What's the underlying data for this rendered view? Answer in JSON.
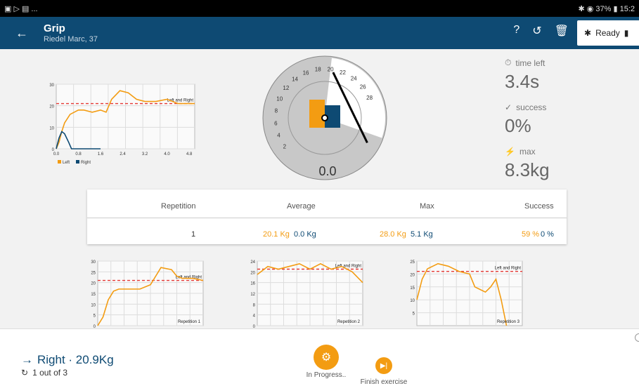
{
  "status_bar": {
    "left": "▣ ▷ ▤ ...",
    "right": "✱ ◉ 37% ▮ 15:2"
  },
  "app_bar": {
    "title": "Grip",
    "subtitle": "Riedel Marc, 37",
    "status_label": "Ready"
  },
  "gauge": {
    "value_text": "0.0",
    "ticks": [
      "2",
      "4",
      "6",
      "8",
      "10",
      "12",
      "14",
      "16",
      "18",
      "20",
      "22",
      "24",
      "26",
      "28"
    ],
    "range": [
      0,
      30
    ],
    "needle_value": 20.5,
    "highlight_start": 20
  },
  "stats": {
    "time_left_label": "time left",
    "time_left": "3.4s",
    "success_label": "success",
    "success": "0%",
    "max_label": "max",
    "max": "8.3kg"
  },
  "table": {
    "headers": [
      "Repetition",
      "Average",
      "Max",
      "Success"
    ],
    "row": {
      "repetition": "1",
      "avg_left": "20.1 Kg",
      "avg_right": "0.0 Kg",
      "max_left": "28.0 Kg",
      "max_right": "5.1 Kg",
      "succ_left": "59 %",
      "succ_right": "0 %"
    }
  },
  "colors": {
    "left": "#f39c12",
    "right": "#0e4a73",
    "target": "#e53935",
    "header": "#0e4a73"
  },
  "chart_data": [
    {
      "type": "line",
      "title": "",
      "xlim": [
        0,
        5
      ],
      "ylim": [
        0,
        30
      ],
      "x_ticks": [
        "0.0",
        "0.8",
        "1.6",
        "2.4",
        "3.2",
        "4.0",
        "4.8"
      ],
      "y_ticks": [
        "0",
        "10",
        "20",
        "30"
      ],
      "target": 21,
      "target_label": "Left and Right",
      "legend": [
        "Left",
        "Right"
      ],
      "legend_position": "bottom-left",
      "series": [
        {
          "name": "Left",
          "x": [
            0,
            0.1,
            0.2,
            0.3,
            0.5,
            0.8,
            1.0,
            1.3,
            1.6,
            1.8,
            2.0,
            2.3,
            2.6,
            2.9,
            3.2,
            3.6,
            4.0,
            4.4,
            4.8,
            5.0
          ],
          "y": [
            0,
            3,
            8,
            12,
            16,
            18,
            18,
            17,
            18,
            17,
            23,
            27,
            26,
            23,
            22,
            22,
            23,
            21,
            21,
            21
          ]
        },
        {
          "name": "Right",
          "x": [
            0,
            0.1,
            0.2,
            0.3,
            0.45,
            0.55,
            0.7,
            1.6
          ],
          "y": [
            0,
            5,
            8,
            7,
            3,
            0,
            0,
            0
          ]
        }
      ]
    },
    {
      "type": "line",
      "title": "Repetition 1",
      "ylim": [
        0,
        30
      ],
      "y_ticks": [
        "0",
        "5",
        "10",
        "15",
        "20",
        "25",
        "30"
      ],
      "target": 21,
      "target_label": "Left and Right",
      "series": [
        {
          "x": [
            0,
            0.05,
            0.1,
            0.15,
            0.2,
            0.3,
            0.4,
            0.5,
            0.6,
            0.7,
            0.75,
            0.8,
            0.9,
            1.0
          ],
          "y": [
            0,
            4,
            12,
            16,
            17,
            17,
            17,
            19,
            27,
            26,
            23,
            22,
            22,
            21
          ]
        }
      ]
    },
    {
      "type": "line",
      "title": "Repetition 2",
      "ylim": [
        0,
        24
      ],
      "y_ticks": [
        "0",
        "4",
        "8",
        "12",
        "16",
        "20",
        "24"
      ],
      "target": 21,
      "target_label": "Left and Right",
      "series": [
        {
          "x": [
            0,
            0.1,
            0.2,
            0.3,
            0.4,
            0.5,
            0.6,
            0.7,
            0.8,
            0.9,
            1.0
          ],
          "y": [
            19,
            22,
            21,
            22,
            23,
            21,
            23,
            21,
            22,
            20,
            16
          ]
        }
      ]
    },
    {
      "type": "line",
      "title": "Repetition 3",
      "ylim": [
        0,
        25
      ],
      "y_ticks": [
        "5",
        "10",
        "15",
        "20",
        "25"
      ],
      "target": 21,
      "target_label": "Left and Right",
      "series": [
        {
          "x": [
            0,
            0.05,
            0.1,
            0.2,
            0.3,
            0.4,
            0.5,
            0.55,
            0.6,
            0.65,
            0.7,
            0.75,
            0.8,
            0.85
          ],
          "y": [
            10,
            18,
            22,
            24,
            23,
            21,
            20,
            15,
            14,
            13,
            15,
            18,
            10,
            0
          ]
        }
      ]
    }
  ],
  "bottom": {
    "side_label": "Right · 20.9Kg",
    "progress": "1 out of 3",
    "in_progress_label": "In Progress..",
    "finish_label": "Finish exercise"
  }
}
